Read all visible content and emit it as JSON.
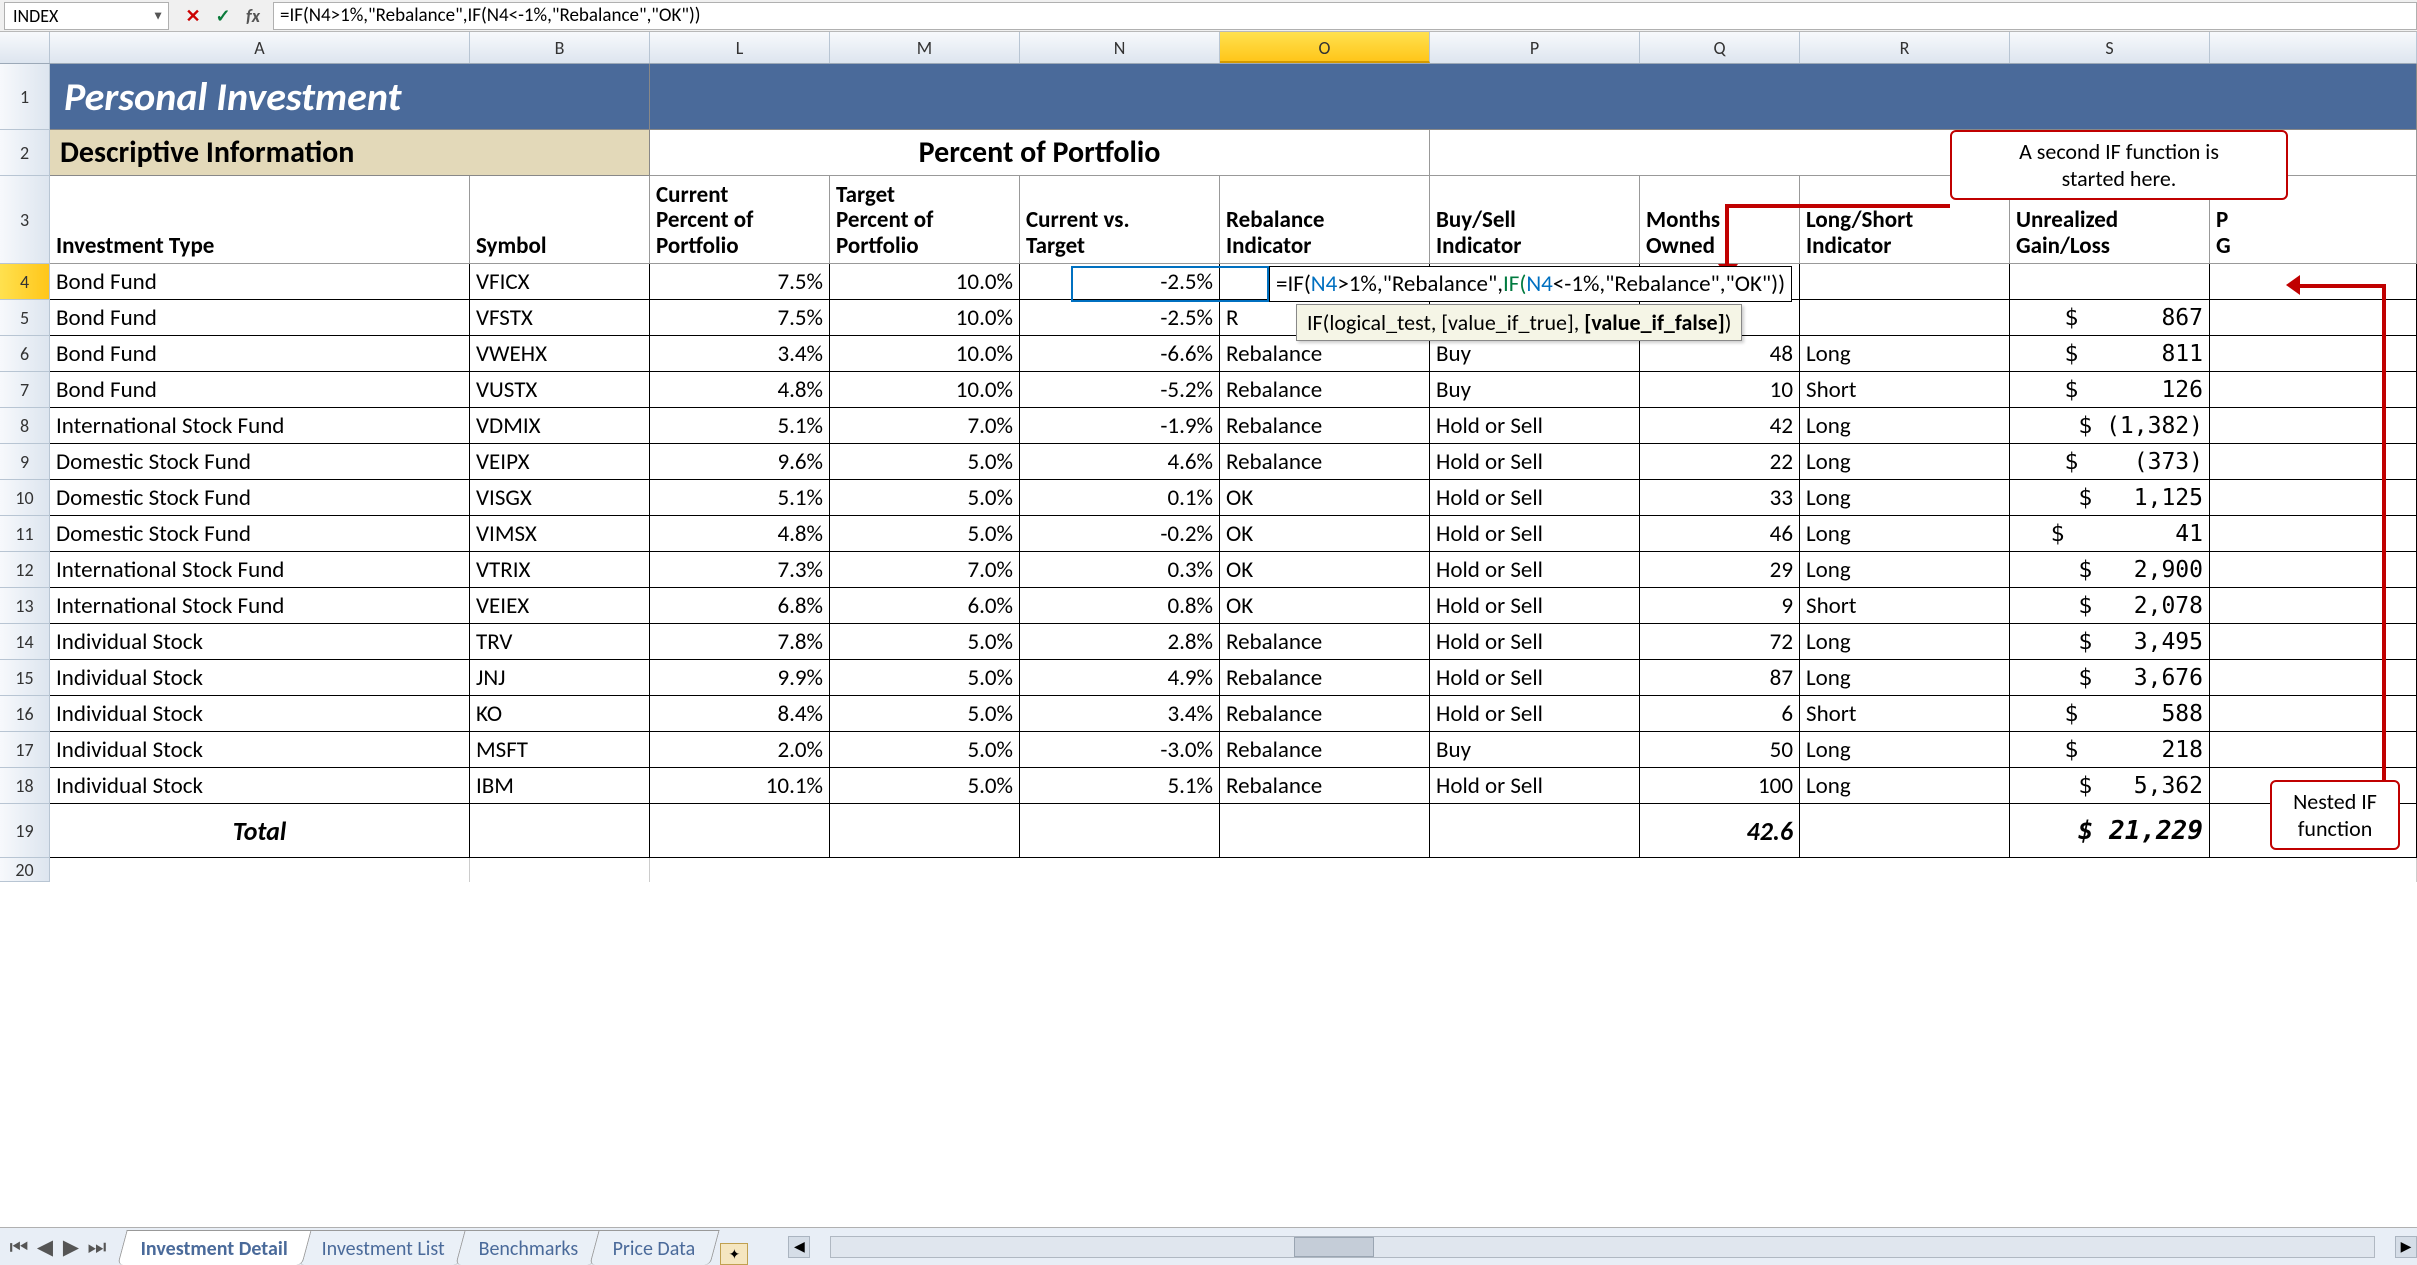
{
  "formula_bar": {
    "name_box": "INDEX",
    "formula": "=IF(N4>1%,\"Rebalance\",IF(N4<-1%,\"Rebalance\",\"OK\"))"
  },
  "columns": [
    "A",
    "B",
    "L",
    "M",
    "N",
    "O",
    "P",
    "Q",
    "R",
    "S",
    "T_stub"
  ],
  "selected_col": "O",
  "selected_row": "4",
  "titles": {
    "main": "Personal Investment",
    "section": "Descriptive Information",
    "pct_section": "Percent of Portfolio"
  },
  "headers3": {
    "invtype": "Investment Type",
    "symbol": "Symbol",
    "curpct": "Current\nPercent of\nPortfolio",
    "tgtpct": "Target\nPercent of\nPortfolio",
    "cvt": "Current vs.\nTarget",
    "rebal": "Rebalance\nIndicator",
    "buysell": "Buy/Sell\nIndicator",
    "months": "Months\nOwned",
    "ls": "Long/Short\nIndicator",
    "ugl": "Unrealized\nGain/Loss",
    "pg": "P\nG"
  },
  "rows": [
    {
      "r": "4",
      "type": "Bond Fund",
      "sym": "VFICX",
      "cur": "7.5%",
      "tgt": "10.0%",
      "cvt": "-2.5%",
      "rebal": "",
      "bs": "",
      "mo": "",
      "ls": "",
      "ugl": ""
    },
    {
      "r": "5",
      "type": "Bond Fund",
      "sym": "VFSTX",
      "cur": "7.5%",
      "tgt": "10.0%",
      "cvt": "-2.5%",
      "rebal": "R",
      "bs": "",
      "mo": "",
      "ls": "",
      "ugl": "$      867"
    },
    {
      "r": "6",
      "type": "Bond Fund",
      "sym": "VWEHX",
      "cur": "3.4%",
      "tgt": "10.0%",
      "cvt": "-6.6%",
      "rebal": "Rebalance",
      "bs": "Buy",
      "mo": "48",
      "ls": "Long",
      "ugl": "$      811"
    },
    {
      "r": "7",
      "type": "Bond Fund",
      "sym": "VUSTX",
      "cur": "4.8%",
      "tgt": "10.0%",
      "cvt": "-5.2%",
      "rebal": "Rebalance",
      "bs": "Buy",
      "mo": "10",
      "ls": "Short",
      "ugl": "$      126"
    },
    {
      "r": "8",
      "type": "International Stock Fund",
      "sym": "VDMIX",
      "cur": "5.1%",
      "tgt": "7.0%",
      "cvt": "-1.9%",
      "rebal": "Rebalance",
      "bs": "Hold or Sell",
      "mo": "42",
      "ls": "Long",
      "ugl": "$ (1,382)"
    },
    {
      "r": "9",
      "type": "Domestic Stock Fund",
      "sym": "VEIPX",
      "cur": "9.6%",
      "tgt": "5.0%",
      "cvt": "4.6%",
      "rebal": "Rebalance",
      "bs": "Hold or Sell",
      "mo": "22",
      "ls": "Long",
      "ugl": "$    (373)"
    },
    {
      "r": "10",
      "type": "Domestic Stock Fund",
      "sym": "VISGX",
      "cur": "5.1%",
      "tgt": "5.0%",
      "cvt": "0.1%",
      "rebal": "OK",
      "bs": "Hold or Sell",
      "mo": "33",
      "ls": "Long",
      "ugl": "$   1,125"
    },
    {
      "r": "11",
      "type": "Domestic Stock Fund",
      "sym": "VIMSX",
      "cur": "4.8%",
      "tgt": "5.0%",
      "cvt": "-0.2%",
      "rebal": "OK",
      "bs": "Hold or Sell",
      "mo": "46",
      "ls": "Long",
      "ugl": "$        41"
    },
    {
      "r": "12",
      "type": "International Stock Fund",
      "sym": "VTRIX",
      "cur": "7.3%",
      "tgt": "7.0%",
      "cvt": "0.3%",
      "rebal": "OK",
      "bs": "Hold or Sell",
      "mo": "29",
      "ls": "Long",
      "ugl": "$   2,900"
    },
    {
      "r": "13",
      "type": "International Stock Fund",
      "sym": "VEIEX",
      "cur": "6.8%",
      "tgt": "6.0%",
      "cvt": "0.8%",
      "rebal": "OK",
      "bs": "Hold or Sell",
      "mo": "9",
      "ls": "Short",
      "ugl": "$   2,078"
    },
    {
      "r": "14",
      "type": "Individual Stock",
      "sym": "TRV",
      "cur": "7.8%",
      "tgt": "5.0%",
      "cvt": "2.8%",
      "rebal": "Rebalance",
      "bs": "Hold or Sell",
      "mo": "72",
      "ls": "Long",
      "ugl": "$   3,495"
    },
    {
      "r": "15",
      "type": "Individual Stock",
      "sym": "JNJ",
      "cur": "9.9%",
      "tgt": "5.0%",
      "cvt": "4.9%",
      "rebal": "Rebalance",
      "bs": "Hold or Sell",
      "mo": "87",
      "ls": "Long",
      "ugl": "$   3,676"
    },
    {
      "r": "16",
      "type": "Individual Stock",
      "sym": "KO",
      "cur": "8.4%",
      "tgt": "5.0%",
      "cvt": "3.4%",
      "rebal": "Rebalance",
      "bs": "Hold or Sell",
      "mo": "6",
      "ls": "Short",
      "ugl": "$      588"
    },
    {
      "r": "17",
      "type": "Individual Stock",
      "sym": "MSFT",
      "cur": "2.0%",
      "tgt": "5.0%",
      "cvt": "-3.0%",
      "rebal": "Rebalance",
      "bs": "Buy",
      "mo": "50",
      "ls": "Long",
      "ugl": "$      218"
    },
    {
      "r": "18",
      "type": "Individual Stock",
      "sym": "IBM",
      "cur": "10.1%",
      "tgt": "5.0%",
      "cvt": "5.1%",
      "rebal": "Rebalance",
      "bs": "Hold or Sell",
      "mo": "100",
      "ls": "Long",
      "ugl": "$   5,362"
    }
  ],
  "total_row": {
    "r": "19",
    "label": "Total",
    "mo": "42.6",
    "ugl": "$ 21,229"
  },
  "tooltip": "IF(logical_test, [value_if_true], [value_if_false])",
  "tooltip_bold": "[value_if_false]",
  "callouts": {
    "c1": "A second IF function is\nstarted here.",
    "c2": "Nested IF\nfunction"
  },
  "tabs": [
    "Investment Detail",
    "Investment List",
    "Benchmarks",
    "Price Data"
  ],
  "active_tab": "Investment Detail",
  "edit_formula_parts": {
    "p1": "=IF(",
    "p2": "N4",
    "p3": ">1%,\"Rebalance\",",
    "p4": "IF(",
    "p5": "N4",
    "p6": "<-1%,\"Rebalance\",\"OK\"))"
  }
}
